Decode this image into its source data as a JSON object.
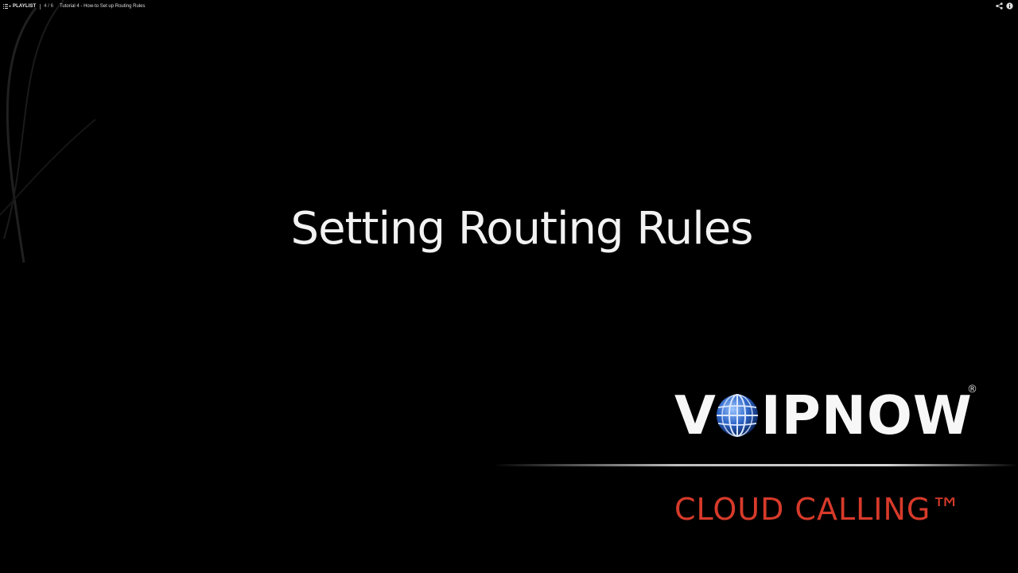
{
  "topbar": {
    "playlist_label": "PLAYLIST",
    "position": "4 / 6",
    "video_title": "Tutorial 4 - How-to Set up Routing Rules",
    "icons": [
      "playlist-icon",
      "share-icon",
      "info-icon"
    ]
  },
  "slide": {
    "title": "Setting Routing Rules",
    "brand_left": "V",
    "brand_right": "IPNOW",
    "brand_registered": "®",
    "tagline": "CLOUD CALLING™"
  },
  "colors": {
    "background": "#000000",
    "title": "#f2f2f2",
    "tagline": "#d73a2a",
    "globe": "#2f66c8"
  }
}
